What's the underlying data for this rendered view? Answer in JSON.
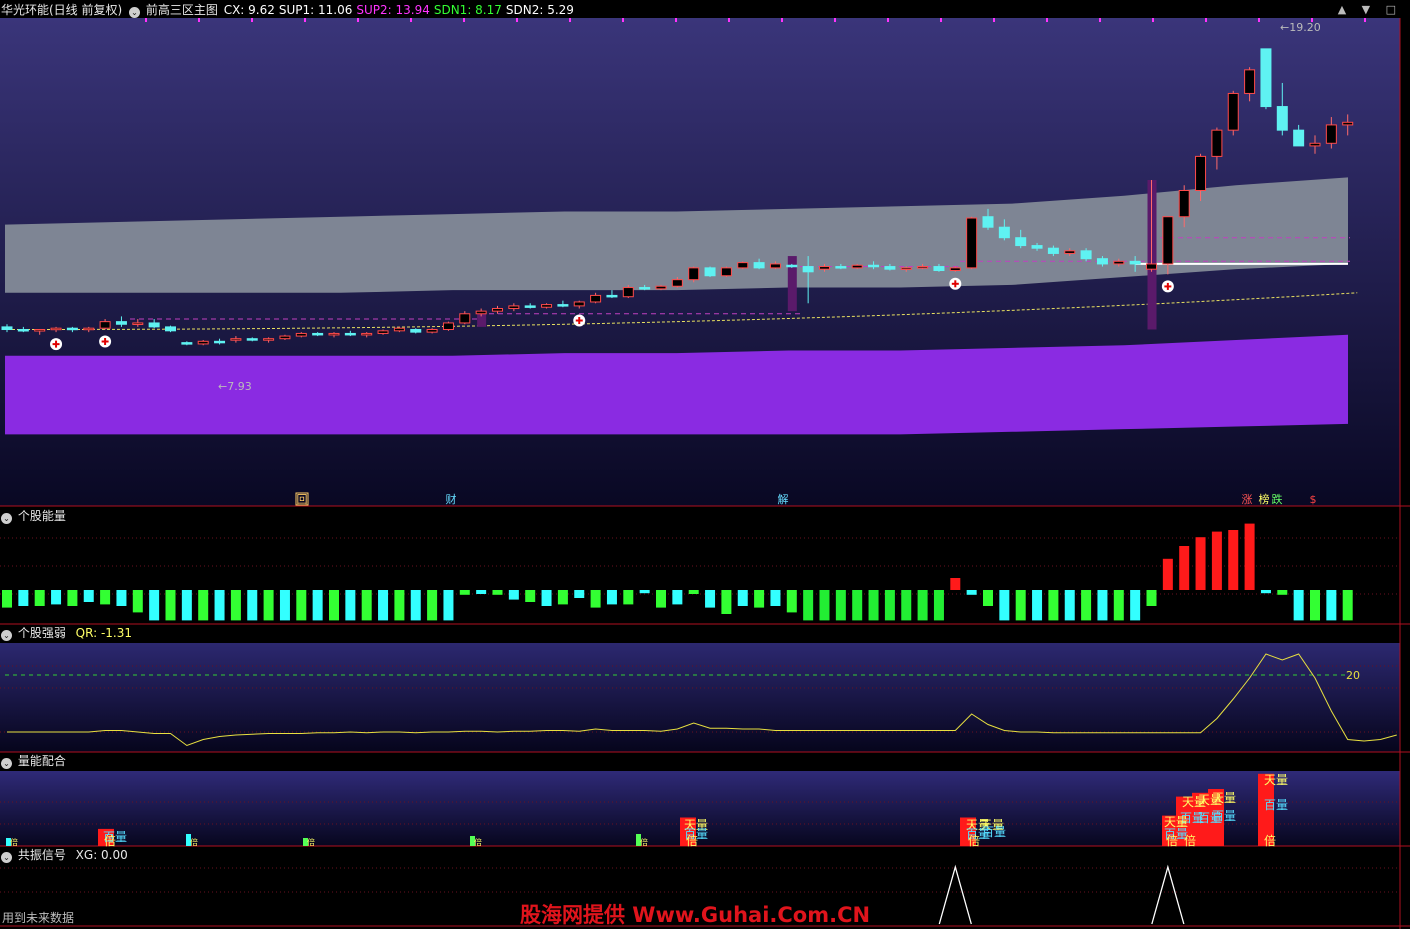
{
  "header": {
    "stock": "华光环能(日线 前复权)",
    "indicator": "前高三区主图",
    "values": [
      {
        "label": "CX: ",
        "value": "9.62",
        "color": "#ffffff"
      },
      {
        "label": "SUP1: ",
        "value": "11.06",
        "color": "#ffffff"
      },
      {
        "label": "SUP2: ",
        "value": "13.94",
        "color": "#ff33ff"
      },
      {
        "label": "SDN1: ",
        "value": "8.17",
        "color": "#33ff33"
      },
      {
        "label": "SDN2: ",
        "value": "5.29",
        "color": "#ffffff"
      }
    ]
  },
  "window_buttons": "▲ ▼ □",
  "panes": {
    "p2": {
      "title": "个股能量"
    },
    "p3": {
      "title": "个股强弱",
      "readout": "QR: -1.31",
      "level_label": "20"
    },
    "p4": {
      "title": "量能配合"
    },
    "p5": {
      "title": "共振信号",
      "readout": "XG: 0.00"
    }
  },
  "markers": [
    {
      "text": "回",
      "color": "#ffcc66",
      "box": true
    },
    {
      "text": "财",
      "color": "#66ddff",
      "box": false
    },
    {
      "text": "解",
      "color": "#66ddff",
      "box": false
    },
    {
      "text": "涨",
      "color": "#ff5555",
      "box": false
    },
    {
      "text": "榜",
      "color": "#ffff66",
      "box": false
    },
    {
      "text": "跌",
      "color": "#66ff66",
      "box": false
    },
    {
      "text": "$",
      "color": "#ff4444",
      "box": false
    }
  ],
  "annotations": {
    "high": "19.20",
    "low": "7.93"
  },
  "footer": {
    "note": "用到未来数据",
    "watermark": "股海网提供 Www.Guhai.Com.CN"
  },
  "chart_data": [
    {
      "type": "candlestick",
      "name": "主图",
      "ylim": [
        2.0,
        20.3
      ],
      "candles": [
        [
          8.6,
          8.7,
          8.4,
          8.5
        ],
        [
          8.5,
          8.6,
          8.4,
          8.45
        ],
        [
          8.45,
          8.5,
          8.3,
          8.5
        ],
        [
          8.5,
          8.6,
          8.4,
          8.55
        ],
        [
          8.55,
          8.6,
          8.4,
          8.5
        ],
        [
          8.5,
          8.6,
          8.4,
          8.55
        ],
        [
          8.55,
          8.9,
          8.5,
          8.8
        ],
        [
          8.8,
          9.0,
          8.6,
          8.7
        ],
        [
          8.7,
          8.9,
          8.6,
          8.75
        ],
        [
          8.75,
          8.9,
          8.55,
          8.6
        ],
        [
          8.6,
          8.65,
          8.4,
          8.45
        ],
        [
          8.0,
          8.05,
          7.9,
          7.95
        ],
        [
          7.95,
          8.1,
          7.9,
          8.05
        ],
        [
          8.05,
          8.15,
          7.93,
          8.0
        ],
        [
          8.1,
          8.25,
          8.0,
          8.15
        ],
        [
          8.15,
          8.2,
          8.05,
          8.1
        ],
        [
          8.1,
          8.2,
          8.0,
          8.15
        ],
        [
          8.15,
          8.3,
          8.1,
          8.25
        ],
        [
          8.25,
          8.4,
          8.2,
          8.35
        ],
        [
          8.35,
          8.4,
          8.25,
          8.3
        ],
        [
          8.3,
          8.4,
          8.2,
          8.35
        ],
        [
          8.35,
          8.45,
          8.25,
          8.3
        ],
        [
          8.3,
          8.4,
          8.2,
          8.35
        ],
        [
          8.35,
          8.5,
          8.3,
          8.45
        ],
        [
          8.45,
          8.6,
          8.4,
          8.55
        ],
        [
          8.5,
          8.55,
          8.35,
          8.4
        ],
        [
          8.4,
          8.55,
          8.35,
          8.5
        ],
        [
          8.5,
          8.8,
          8.45,
          8.75
        ],
        [
          8.75,
          9.2,
          8.7,
          9.1
        ],
        [
          9.1,
          9.3,
          9.0,
          9.2
        ],
        [
          9.2,
          9.4,
          9.1,
          9.3
        ],
        [
          9.3,
          9.5,
          9.2,
          9.4
        ],
        [
          9.4,
          9.5,
          9.3,
          9.35
        ],
        [
          9.35,
          9.5,
          9.3,
          9.45
        ],
        [
          9.45,
          9.6,
          9.35,
          9.4
        ],
        [
          9.4,
          9.6,
          9.3,
          9.55
        ],
        [
          9.55,
          9.9,
          9.5,
          9.8
        ],
        [
          9.8,
          10.0,
          9.7,
          9.75
        ],
        [
          9.75,
          10.2,
          9.7,
          10.1
        ],
        [
          10.1,
          10.2,
          10.0,
          10.05
        ],
        [
          10.05,
          10.2,
          10.0,
          10.15
        ],
        [
          10.15,
          10.5,
          10.1,
          10.4
        ],
        [
          10.4,
          10.9,
          10.3,
          10.85
        ],
        [
          10.85,
          10.9,
          10.5,
          10.55
        ],
        [
          10.55,
          10.9,
          10.5,
          10.85
        ],
        [
          10.85,
          11.1,
          10.8,
          11.05
        ],
        [
          11.05,
          11.2,
          10.8,
          10.85
        ],
        [
          10.85,
          11.1,
          10.8,
          11.0
        ],
        [
          10.95,
          11.0,
          10.85,
          10.9
        ],
        [
          10.9,
          11.3,
          9.5,
          10.7
        ],
        [
          10.8,
          11.0,
          10.7,
          10.9
        ],
        [
          10.9,
          11.0,
          10.8,
          10.85
        ],
        [
          10.85,
          11.0,
          10.8,
          10.95
        ],
        [
          10.95,
          11.1,
          10.8,
          10.9
        ],
        [
          10.9,
          11.0,
          10.75,
          10.8
        ],
        [
          10.8,
          10.9,
          10.7,
          10.85
        ],
        [
          10.85,
          11.0,
          10.8,
          10.9
        ],
        [
          10.9,
          11.0,
          10.7,
          10.75
        ],
        [
          10.75,
          10.9,
          10.7,
          10.85
        ],
        [
          10.85,
          12.8,
          10.8,
          12.75
        ],
        [
          12.8,
          13.1,
          12.3,
          12.4
        ],
        [
          12.4,
          12.7,
          11.9,
          12.0
        ],
        [
          12.0,
          12.3,
          11.6,
          11.7
        ],
        [
          11.7,
          11.8,
          11.5,
          11.6
        ],
        [
          11.6,
          11.7,
          11.3,
          11.4
        ],
        [
          11.4,
          11.6,
          11.3,
          11.5
        ],
        [
          11.5,
          11.6,
          11.1,
          11.2
        ],
        [
          11.2,
          11.3,
          10.9,
          11.0
        ],
        [
          11.0,
          11.2,
          10.9,
          11.1
        ],
        [
          11.1,
          11.3,
          10.7,
          11.0
        ],
        [
          10.8,
          14.2,
          10.7,
          11.0
        ],
        [
          11.0,
          12.8,
          10.6,
          12.8
        ],
        [
          12.8,
          14.0,
          12.4,
          13.8
        ],
        [
          13.8,
          15.2,
          13.4,
          15.1
        ],
        [
          15.1,
          16.2,
          14.6,
          16.1
        ],
        [
          16.1,
          17.6,
          15.9,
          17.5
        ],
        [
          17.5,
          18.5,
          17.2,
          18.4
        ],
        [
          19.2,
          19.2,
          16.9,
          17.0
        ],
        [
          17.0,
          17.9,
          15.9,
          16.1
        ],
        [
          16.1,
          16.3,
          15.5,
          15.5
        ],
        [
          15.5,
          15.9,
          15.2,
          15.6
        ],
        [
          15.6,
          16.6,
          15.4,
          16.3
        ],
        [
          16.3,
          16.7,
          15.9,
          16.4
        ]
      ],
      "bands": {
        "gray_upper": [
          12.5,
          12.6,
          12.7,
          12.8,
          12.9,
          13.0,
          13.0,
          13.1,
          13.2,
          13.3,
          13.6,
          14.0,
          14.3
        ],
        "gray_lower": [
          9.9,
          9.9,
          9.9,
          9.9,
          10.0,
          10.0,
          10.0,
          10.1,
          10.1,
          10.2,
          10.5,
          10.8,
          11.0
        ],
        "purple_upper": [
          7.5,
          7.5,
          7.5,
          7.5,
          7.5,
          7.6,
          7.6,
          7.7,
          7.7,
          7.8,
          7.9,
          8.1,
          8.3
        ],
        "purple_lower": [
          4.5,
          4.5,
          4.5,
          4.5,
          4.5,
          4.5,
          4.5,
          4.5,
          4.5,
          4.6,
          4.7,
          4.8,
          4.9
        ]
      },
      "dashed_support": {
        "start": 8.5,
        "end": 9.9
      },
      "white_line": {
        "from_index": 69,
        "value": 11.0
      },
      "buy_signals": [
        3,
        6,
        35,
        58,
        71
      ]
    },
    {
      "type": "bar",
      "name": "个股能量",
      "values": [
        -2.2,
        -2.0,
        -2.0,
        -1.8,
        -2.0,
        -1.5,
        -1.8,
        -2.0,
        -2.8,
        -3.8,
        -3.8,
        -3.8,
        -3.8,
        -3.8,
        -3.8,
        -3.8,
        -3.8,
        -3.8,
        -3.8,
        -3.8,
        -3.8,
        -3.8,
        -3.8,
        -3.8,
        -3.8,
        -3.8,
        -3.8,
        -3.8,
        -0.6,
        -0.5,
        -0.6,
        -1.2,
        -1.5,
        -2.0,
        -1.8,
        -1.0,
        -2.2,
        -1.8,
        -1.8,
        -0.4,
        -2.2,
        -1.8,
        -0.5,
        -2.2,
        -3.0,
        -2.0,
        -2.2,
        -2.0,
        -2.8,
        -3.8,
        -3.8,
        -3.8,
        -3.8,
        -3.8,
        -3.8,
        -3.8,
        -3.8,
        -3.8,
        1.5,
        -0.6,
        -2.0,
        -3.8,
        -3.8,
        -3.8,
        -3.8,
        -3.8,
        -3.8,
        -3.8,
        -3.8,
        -3.8,
        -2.0,
        3.9,
        5.5,
        6.6,
        7.3,
        7.5,
        8.3,
        -0.4,
        -0.6,
        -3.8,
        -3.8,
        -3.8,
        -3.8
      ],
      "colors_order": "alternating green/cyan by index"
    },
    {
      "type": "line",
      "name": "个股强弱",
      "values": [
        -18,
        -18,
        -18,
        -18,
        -18,
        -18,
        -17,
        -17,
        -18,
        -19,
        -19,
        -27,
        -23,
        -21,
        -20,
        -19.5,
        -19,
        -19,
        -19,
        -18.5,
        -18.5,
        -18,
        -18.5,
        -18,
        -18,
        -18.5,
        -18,
        -18,
        -17.5,
        -17.5,
        -18,
        -17.5,
        -17.5,
        -17,
        -17,
        -17.5,
        -16,
        -17,
        -17,
        -17,
        -17.5,
        -16,
        -12,
        -15.5,
        -15.5,
        -16,
        -16,
        -17,
        -17,
        -17,
        -17,
        -17,
        -17,
        -17,
        -17,
        -17,
        -17,
        -17,
        -17,
        -6,
        -13,
        -17,
        -18,
        -18,
        -18.5,
        -18.5,
        -18.5,
        -18.5,
        -18.5,
        -18.5,
        -18.5,
        -18.5,
        -18.5,
        -18.5,
        -9,
        4,
        18,
        34,
        30,
        34,
        18,
        -4,
        -23,
        -24,
        -23,
        -20
      ],
      "level": 20,
      "ylim": [
        -30,
        40
      ]
    },
    {
      "type": "bar",
      "name": "量能配合",
      "series_labels": [
        "天量",
        "百量",
        "倍"
      ],
      "values": [
        0.1,
        0.15,
        0.15,
        0.45,
        0.1,
        0.1,
        0.45,
        0.2,
        0.1,
        0.1,
        0.3,
        0.1,
        0.1,
        0.25,
        0.2,
        0.1,
        1.0,
        0.1,
        0.1,
        0.1,
        1.0,
        0.1,
        1.0,
        1.0,
        1.0,
        1.4,
        1.8,
        1.8,
        3.4
      ]
    },
    {
      "type": "line",
      "name": "共振信号",
      "peaks_at": [
        58,
        71
      ],
      "values_range": [
        0,
        1
      ]
    }
  ]
}
